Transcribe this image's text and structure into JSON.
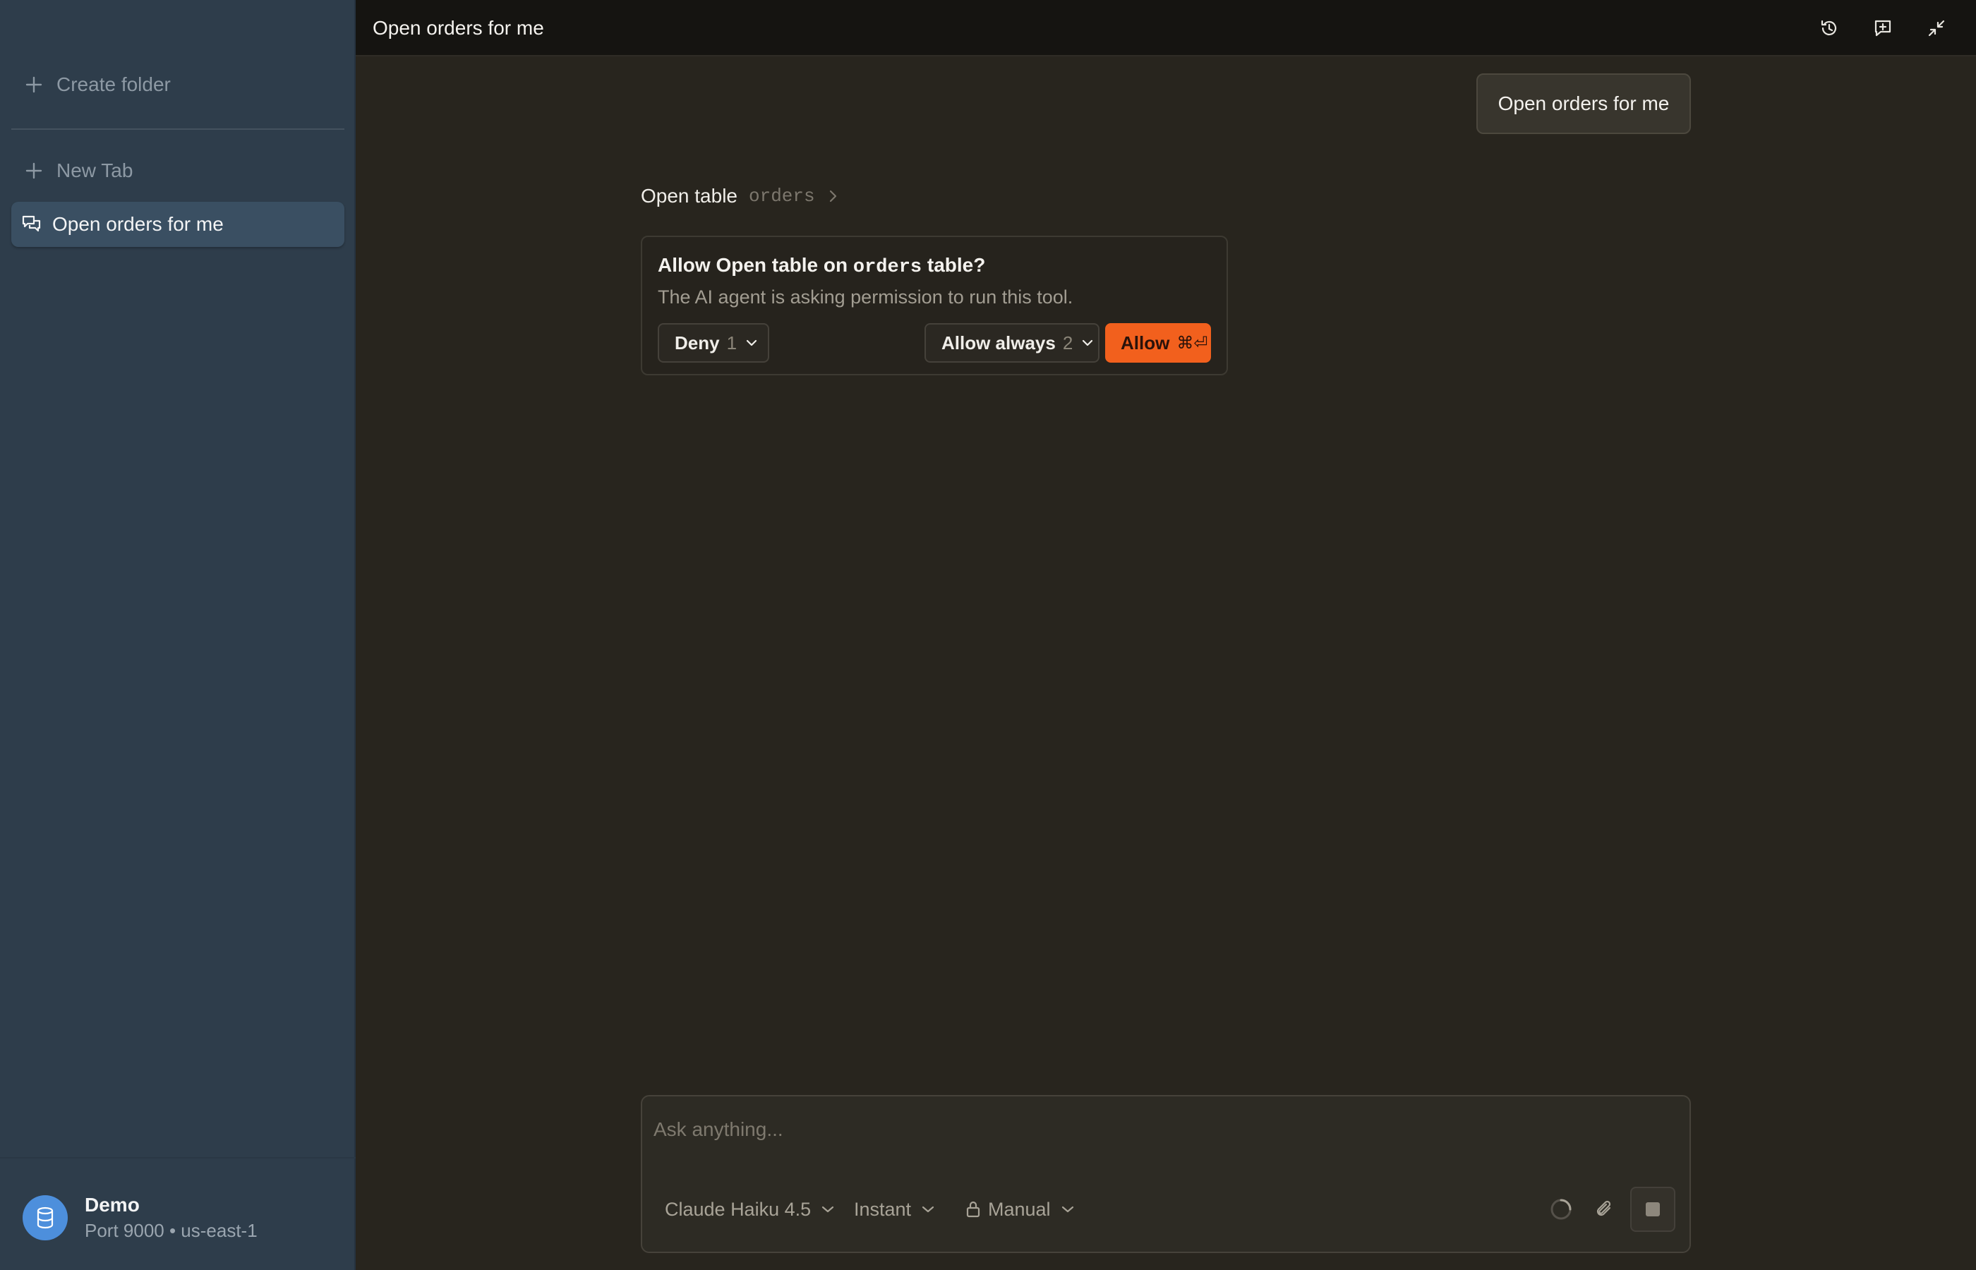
{
  "sidebar": {
    "create_folder_label": "Create folder",
    "new_tab_label": "New Tab",
    "active_tab_label": "Open orders for me",
    "connection": {
      "name": "Demo",
      "details": "Port 9000 • us-east-1"
    }
  },
  "header": {
    "title": "Open orders for me",
    "icons": [
      "history-icon",
      "new-chat-icon",
      "collapse-icon"
    ]
  },
  "chat": {
    "user_message": "Open orders for me",
    "tool_call": {
      "name": "Open table",
      "argument": "orders"
    },
    "permission": {
      "title_prefix": "Allow Open table on",
      "title_code": "orders",
      "title_suffix": "table?",
      "description": "The AI agent is asking permission to run this tool.",
      "deny_label": "Deny",
      "deny_shortcut": "1",
      "allow_always_label": "Allow always",
      "allow_always_shortcut": "2",
      "allow_label": "Allow",
      "allow_shortcut": "⌘⏎"
    }
  },
  "composer": {
    "placeholder": "Ask anything...",
    "model": "Claude Haiku 4.5",
    "mode": "Instant",
    "permission_mode": "Manual"
  },
  "colors": {
    "accent": "#f2601d",
    "sidebar_bg": "#2e3d4b",
    "main_bg": "#28251e",
    "avatar": "#4d8fdc"
  }
}
